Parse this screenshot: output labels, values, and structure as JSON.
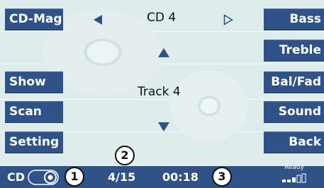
{
  "header": {
    "left_button": "CD-Mag",
    "disc_label": "CD 4",
    "prev_icon": "triangle-left-icon",
    "next_icon": "triangle-right-outline-icon"
  },
  "left_buttons": [
    "Show",
    "Scan",
    "Setting"
  ],
  "right_buttons": [
    "Bass",
    "Treble",
    "Bal/Fad",
    "Sound",
    "Back"
  ],
  "center": {
    "up_icon": "triangle-up-icon",
    "track_label": "Track 4",
    "down_icon": "triangle-down-icon"
  },
  "status_bar": {
    "source": "CD",
    "disc_icon": "disc-icon",
    "track_position": "4/15",
    "elapsed_time": "00:18",
    "ready_label": "Ready",
    "signal_icon": "signal-bars-icon"
  },
  "callouts": [
    "1",
    "2",
    "3"
  ],
  "colors": {
    "button_blue": "#2f5289",
    "screen_bg": "#dfecec",
    "arrow_blue": "#2f5289"
  }
}
